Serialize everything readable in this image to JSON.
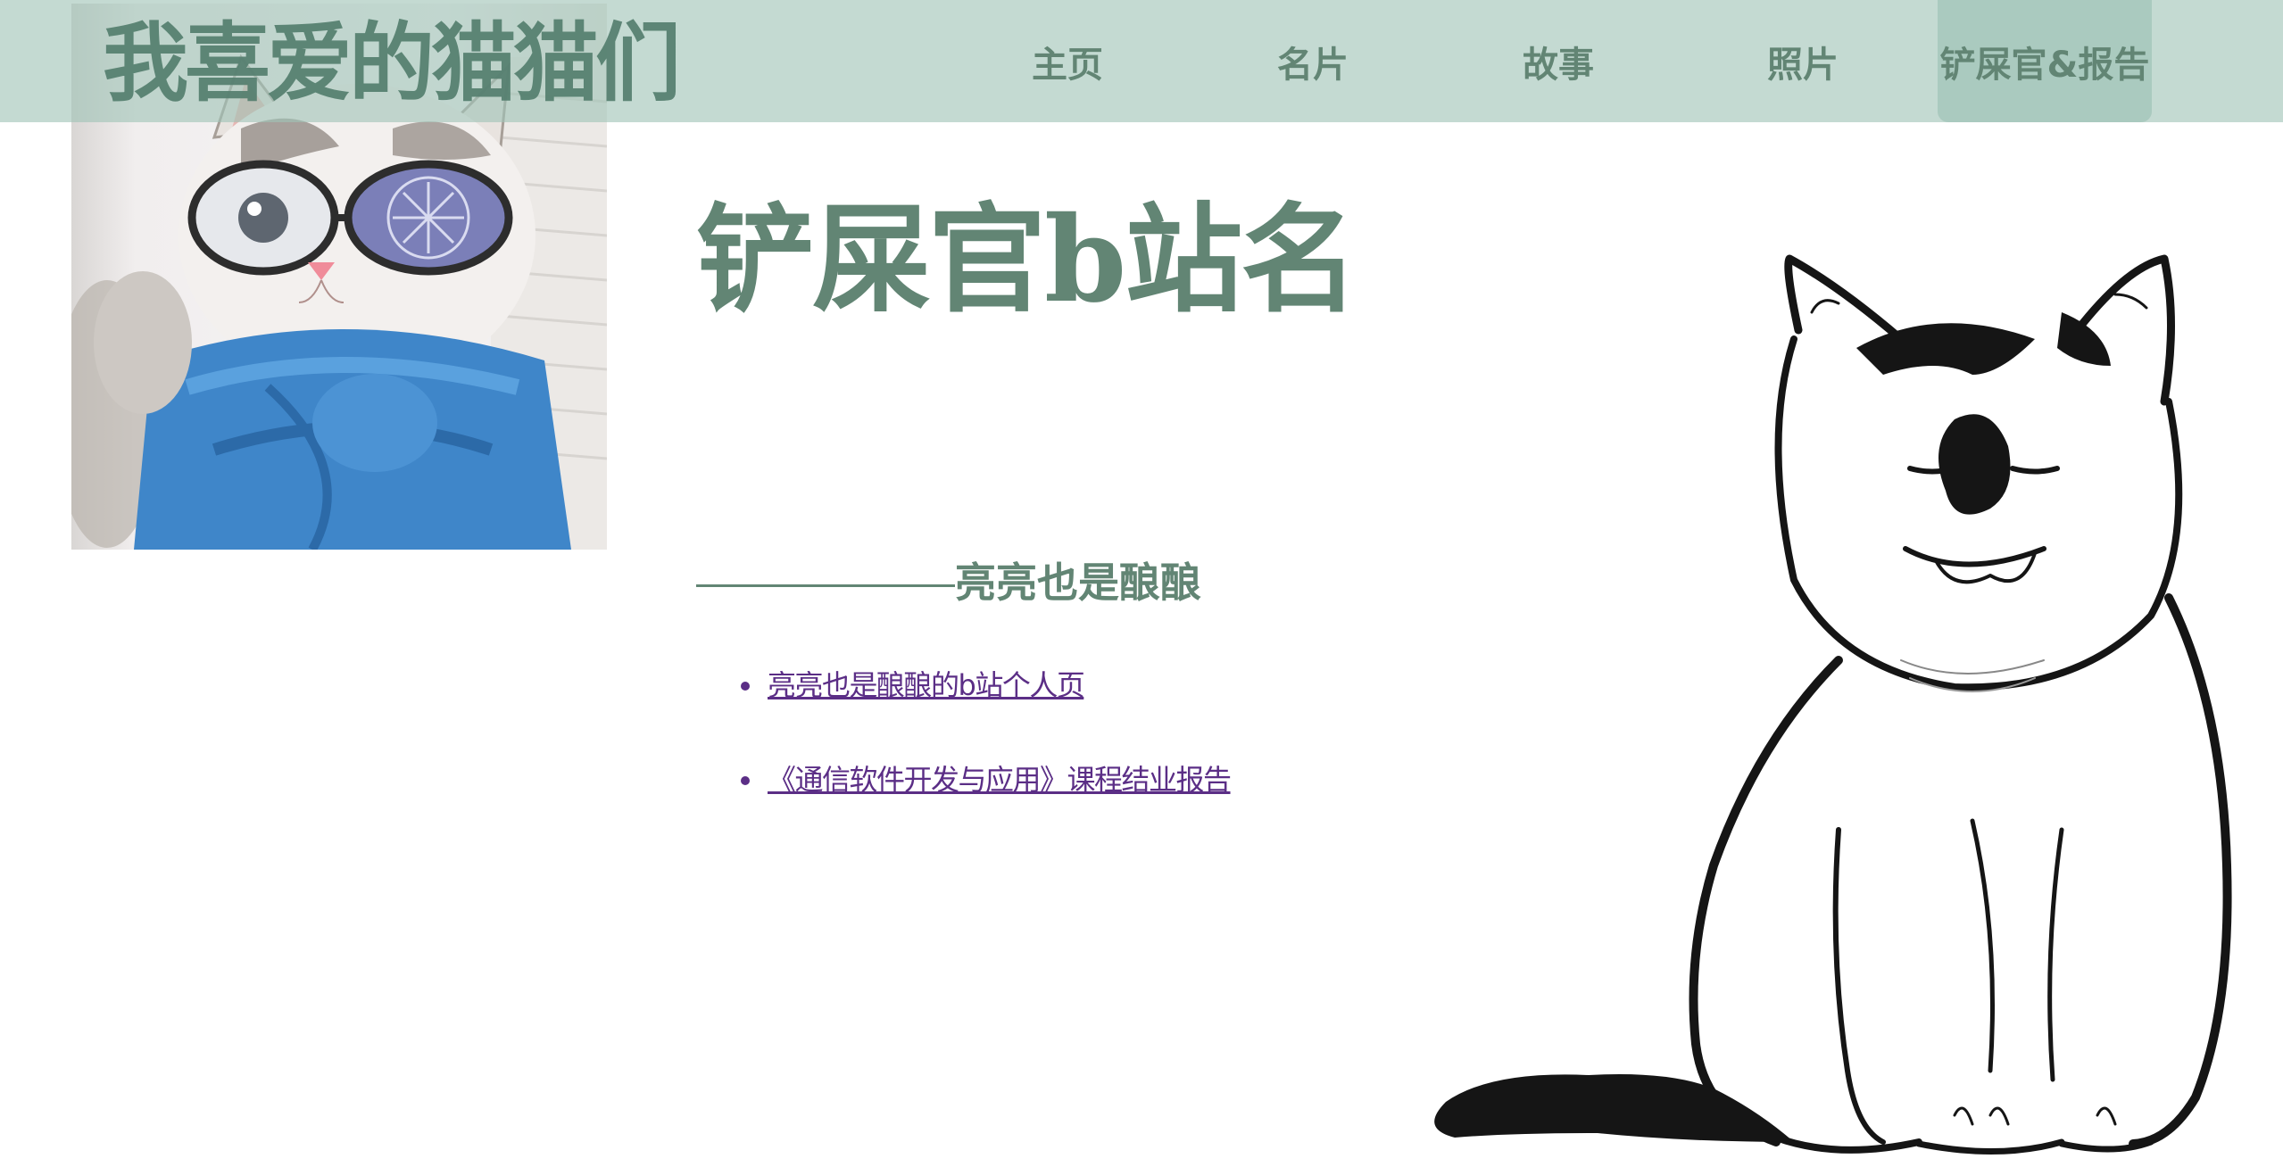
{
  "header": {
    "site_title": "我喜爱的猫猫们",
    "nav": [
      {
        "label": "主页"
      },
      {
        "label": "名片"
      },
      {
        "label": "故事"
      },
      {
        "label": "照片"
      },
      {
        "label": "铲屎官&报告",
        "active": true
      }
    ]
  },
  "main": {
    "heading": "铲屎官b站名",
    "subtitle": "亮亮也是酿酿",
    "links": [
      {
        "label": "亮亮也是酿酿的b站个人页"
      },
      {
        "label": "《通信软件开发与应用》课程结业报告"
      }
    ]
  },
  "colors": {
    "accent": "#628574",
    "nav_background": "#a0c4b6",
    "link": "#5b2e86"
  },
  "images": {
    "profile_photo": "cat-with-glasses-and-blue-scarf",
    "illustration": "ink-drawing-smiling-cat"
  }
}
